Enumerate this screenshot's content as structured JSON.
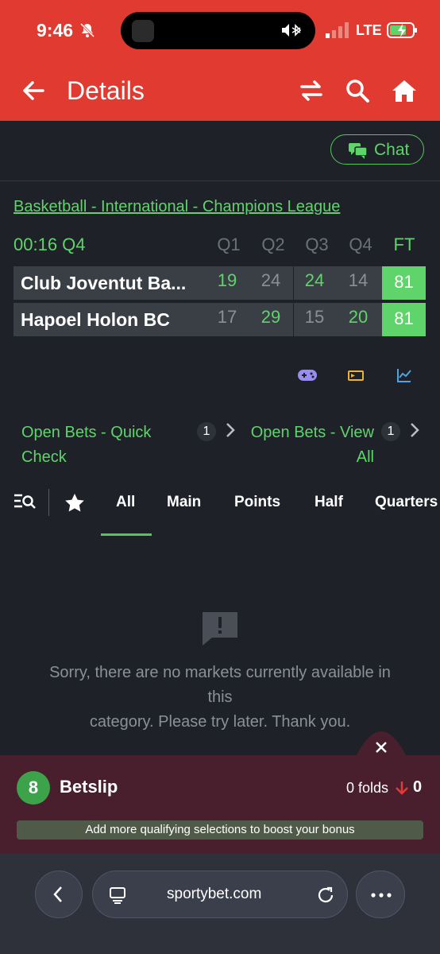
{
  "status": {
    "time": "9:46",
    "network": "LTE"
  },
  "header": {
    "title": "Details"
  },
  "chat": {
    "label": "Chat"
  },
  "match": {
    "league": "Basketball - International - Champions League",
    "clock": "00:16 Q4",
    "columns": [
      "Q1",
      "Q2",
      "Q3",
      "Q4",
      "FT"
    ],
    "teams": [
      {
        "name": "Club Joventut Ba...",
        "scores": [
          "19",
          "24",
          "24",
          "14"
        ],
        "ft": "81"
      },
      {
        "name": "Hapoel Holon BC",
        "scores": [
          "17",
          "29",
          "15",
          "20"
        ],
        "ft": "81"
      }
    ]
  },
  "open_bets": {
    "quick_check": {
      "line1": "Open Bets - Quick",
      "line2": "Check",
      "count": "1"
    },
    "view_all": {
      "line1": "Open Bets - View",
      "line2": "All",
      "count": "1"
    }
  },
  "tabs": [
    "All",
    "Main",
    "Points",
    "Half",
    "Quarters"
  ],
  "active_tab": "All",
  "empty": {
    "line1": "Sorry, there are no markets currently available in",
    "line2": "this",
    "line3": "category. Please try later. Thank you."
  },
  "betslip": {
    "count": "8",
    "label": "Betslip",
    "folds": "0 folds",
    "folds_value": "0",
    "boost_message": "Add more qualifying selections to boost your bonus"
  },
  "browser": {
    "url": "sportybet.com"
  },
  "colors": {
    "brand_red": "#e03a31",
    "accent_green": "#5fd46a",
    "background": "#1e2228",
    "betslip_bg": "#4a1f2d"
  }
}
